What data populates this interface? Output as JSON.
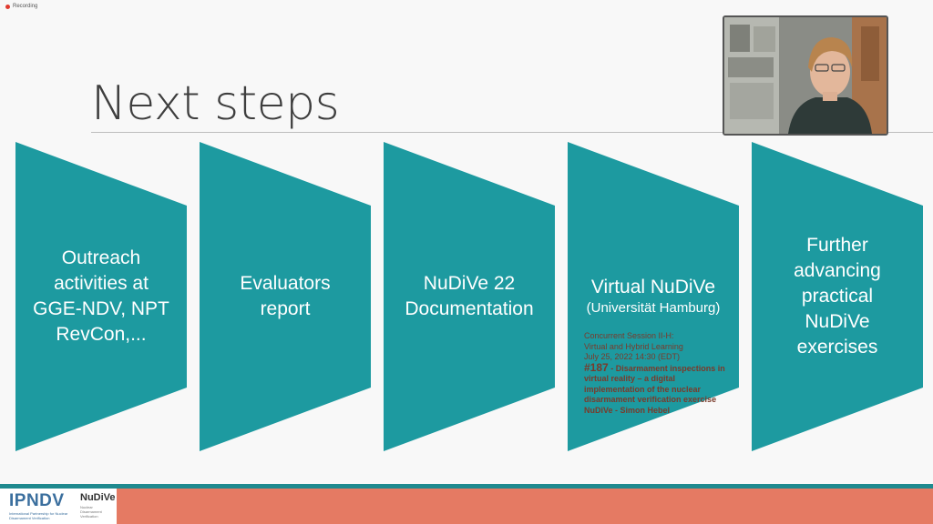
{
  "recording": {
    "label": "Recording"
  },
  "slide": {
    "title": "Next steps",
    "steps": [
      {
        "label": "Outreach activities at GGE-NDV, NPT RevCon,..."
      },
      {
        "label": "Evaluators report"
      },
      {
        "label": "NuDiVe 22 Documentation"
      },
      {
        "label": "Virtual NuDiVe",
        "sublabel": "(Universität Hamburg)",
        "session": {
          "line1": "Concurrent Session II-H:",
          "line2": "Virtual and Hybrid Learning",
          "date": "July 25, 2022 14:30 (EDT)",
          "number": "#187",
          "talk": "- Disarmament inspections in virtual reality – a digital implementation of the nuclear disarmament verification exercise NuDiVe - Simon Hebel"
        }
      },
      {
        "label": "Further advancing practical NuDiVe exercises"
      }
    ]
  },
  "footer": {
    "ipndv_logo": "IPNDV",
    "ipndv_sub": "International Partnership for Nuclear Disarmament Verification",
    "nudive_logo": "NuDiVe",
    "nudive_sub": "Nuclear Disarmament Verification"
  },
  "colors": {
    "arrow": "#1d9aa0",
    "footer_band": "#e57a63",
    "footer_line": "#1f8a8f",
    "title": "#3e3e3e"
  }
}
